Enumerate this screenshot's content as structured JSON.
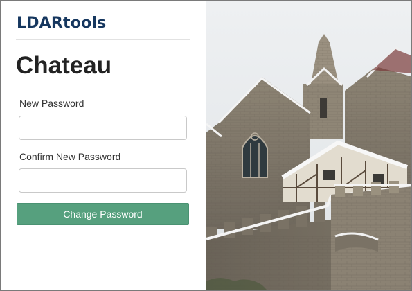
{
  "brand": {
    "logo_text": "LDARtools"
  },
  "page": {
    "title": "Chateau"
  },
  "form": {
    "new_password_label": "New Password",
    "new_password_value": "",
    "confirm_password_label": "Confirm New Password",
    "confirm_password_value": "",
    "submit_label": "Change Password"
  },
  "colors": {
    "brand": "#16375f",
    "accent": "#56a07e"
  },
  "background": {
    "image": "castle-photo"
  }
}
